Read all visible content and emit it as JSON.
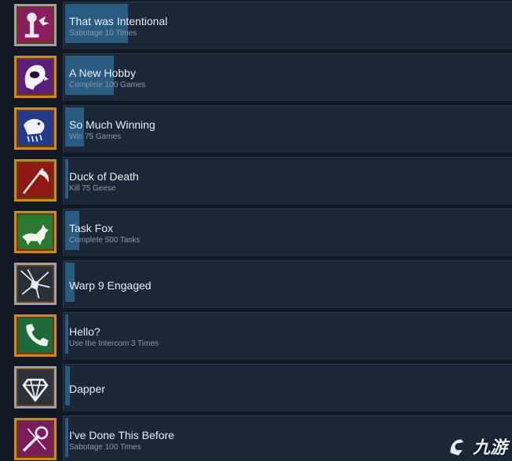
{
  "achievements": [
    {
      "title": "That was Intentional",
      "desc": "Sabotage 10 Times",
      "progress": 0.14,
      "icon": "bomb-explosion-icon",
      "frame": "silver",
      "bg": "#8a1d5c"
    },
    {
      "title": "A New Hobby",
      "desc": "Complete 100 Games",
      "progress": 0.11,
      "icon": "crewmate-face-icon",
      "frame": "gold",
      "bg": "#5a1f7a"
    },
    {
      "title": "So Much Winning",
      "desc": "Win 75 Games",
      "progress": 0.04,
      "icon": "bird-icon",
      "frame": "gold",
      "bg": "#233a8c"
    },
    {
      "title": "Duck of Death",
      "desc": "Kill 75 Geese",
      "progress": 0.0,
      "icon": "scythe-icon",
      "frame": "gold",
      "bg": "#8f1a14"
    },
    {
      "title": "Task Fox",
      "desc": "Complete 500 Tasks",
      "progress": 0.03,
      "icon": "fox-icon",
      "frame": "gold",
      "bg": "#2a7a30"
    },
    {
      "title": "Warp 9 Engaged",
      "desc": "",
      "progress": 0.02,
      "icon": "warp-icon",
      "frame": "silver",
      "bg": "#2a3038"
    },
    {
      "title": "Hello?",
      "desc": "Use the Intercom 3 Times",
      "progress": 0.0,
      "icon": "phone-icon",
      "frame": "gold",
      "bg": "#1f6a3a"
    },
    {
      "title": "Dapper",
      "desc": "",
      "progress": 0.0,
      "icon": "diamond-icon",
      "frame": "silver",
      "bg": "#2b323a"
    },
    {
      "title": "I've Done This Before",
      "desc": "Sabotage 100 Times",
      "progress": 0.0,
      "icon": "wrench-icon",
      "frame": "gold",
      "bg": "#7a1d5a"
    }
  ],
  "watermark": {
    "text": "九游",
    "icon": "nine-game-logo-icon"
  }
}
